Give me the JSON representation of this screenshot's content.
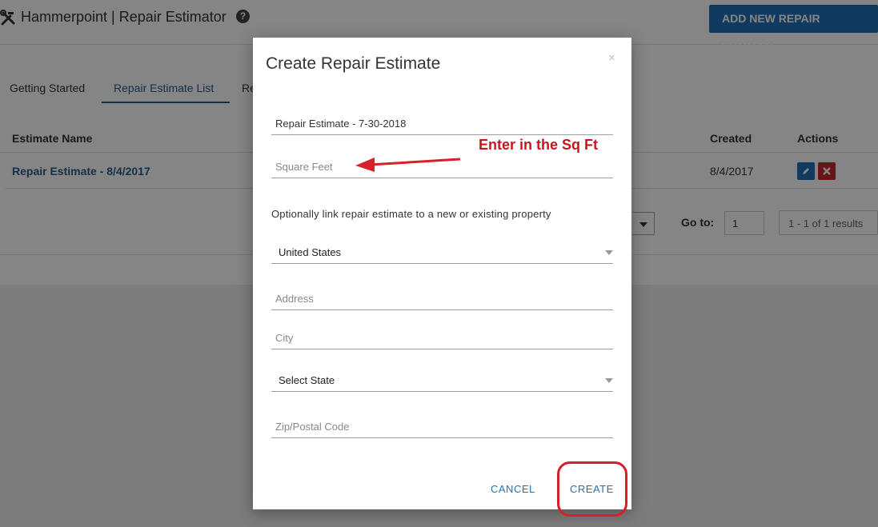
{
  "header": {
    "title": "Hammerpoint | Repair Estimator",
    "help_glyph": "?",
    "add_button": "ADD NEW REPAIR ESTIMATE",
    "brand_color": "#1f70b8"
  },
  "tabs": [
    {
      "label": "Getting Started",
      "active": false
    },
    {
      "label": "Repair Estimate List",
      "active": true
    },
    {
      "label": "Re",
      "active": false
    }
  ],
  "table": {
    "columns": {
      "name": "Estimate Name",
      "created": "Created",
      "actions": "Actions"
    },
    "rows": [
      {
        "name": "Repair Estimate - 8/4/2017",
        "created": "8/4/2017",
        "edit_icon": "pencil-icon",
        "delete_icon": "x-icon"
      }
    ]
  },
  "pager": {
    "goto_label": "Go to:",
    "goto_value": "1",
    "results_text": "1 - 1 of 1 results"
  },
  "modal": {
    "title": "Create Repair Estimate",
    "close_glyph": "×",
    "estimate_name_value": "Repair Estimate - 7-30-2018",
    "square_feet_placeholder": "Square Feet",
    "link_note": "Optionally link repair estimate to a new or existing property",
    "country_value": "United States",
    "address_placeholder": "Address",
    "city_placeholder": "City",
    "state_value": "Select State",
    "zip_placeholder": "Zip/Postal Code",
    "cancel_label": "CANCEL",
    "create_label": "CREATE"
  },
  "annotation": {
    "text": "Enter in the Sq Ft",
    "color": "#c8141e"
  }
}
